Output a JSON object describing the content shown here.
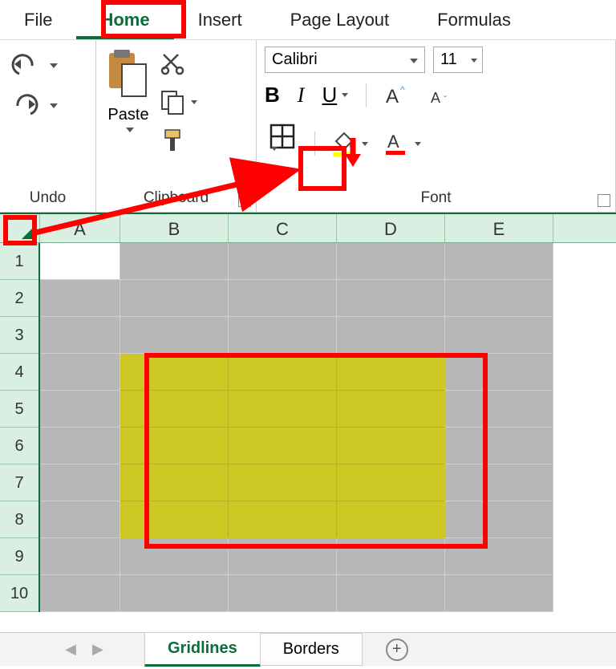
{
  "tabs": {
    "file": "File",
    "home": "Home",
    "insert": "Insert",
    "page_layout": "Page Layout",
    "formulas": "Formulas",
    "active": "Home"
  },
  "ribbon": {
    "undo": {
      "label": "Undo"
    },
    "clipboard": {
      "paste": "Paste",
      "label": "Clipboard"
    },
    "font": {
      "name": "Calibri",
      "size": "11",
      "label": "Font"
    }
  },
  "columns": [
    "A",
    "B",
    "C",
    "D",
    "E"
  ],
  "rows": [
    "1",
    "2",
    "3",
    "4",
    "5",
    "6",
    "7",
    "8",
    "9",
    "10"
  ],
  "sheets": {
    "tab1": "Gridlines",
    "tab2": "Borders",
    "active": "Gridlines"
  },
  "highlighted_range": "B4:D8"
}
